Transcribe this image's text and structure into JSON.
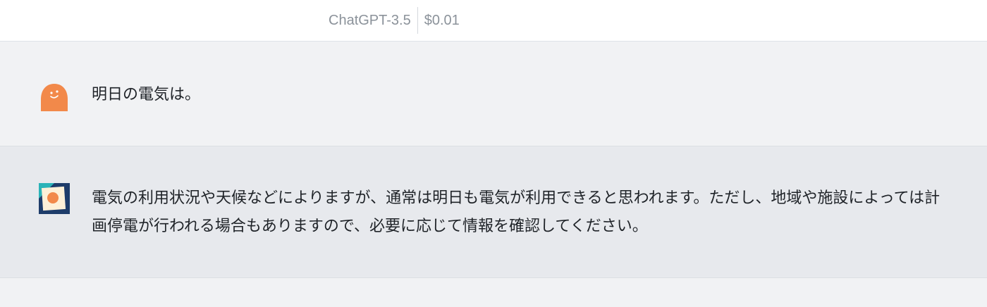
{
  "header": {
    "model_name": "ChatGPT-3.5",
    "cost": "$0.01"
  },
  "messages": [
    {
      "role": "user",
      "avatar_icon": "orange-blob-avatar-icon",
      "text": "明日の電気は。"
    },
    {
      "role": "assistant",
      "avatar_icon": "orange-dot-card-avatar-icon",
      "text": "電気の利用状況や天候などによりますが、通常は明日も電気が利用できると思われます。ただし、地域や施設によっては計画停電が行われる場合もありますので、必要に応じて情報を確認してください。"
    }
  ],
  "colors": {
    "header_bg": "#ffffff",
    "user_msg_bg": "#f1f2f4",
    "assistant_msg_bg": "#e7e9ed",
    "avatar_orange": "#f2894a",
    "avatar_card_navy": "#1e3c6a",
    "avatar_card_teal": "#2ab3b8",
    "avatar_card_cream": "#fdf0d8"
  }
}
